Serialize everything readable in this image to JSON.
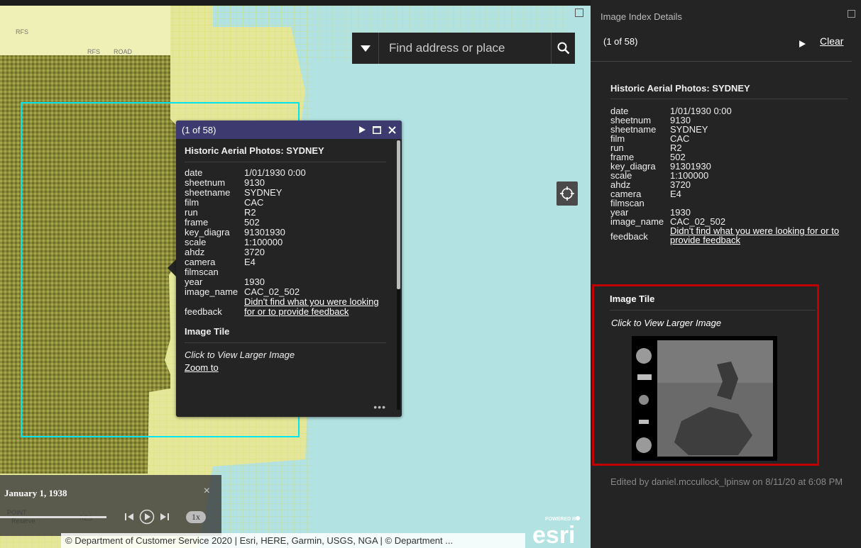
{
  "map": {
    "search_placeholder": "Find address or place",
    "map_labels": [
      "RFS",
      "RFS",
      "ROAD",
      "POINT",
      "Reserve",
      "RES"
    ],
    "timeslider": {
      "date": "January 1, 1938",
      "speed": "1x",
      "close": "×"
    },
    "attribution": "© Department of Customer Service 2020 | Esri, HERE, Garmin, USGS, NGA | © Department ...",
    "esri": {
      "powered_by": "POWERED BY",
      "brand": "esri"
    }
  },
  "popup": {
    "count": "(1 of 58)",
    "title": "Historic Aerial Photos: SYDNEY",
    "fields": [
      {
        "k": "date",
        "v": "1/01/1930 0:00"
      },
      {
        "k": "sheetnum",
        "v": "9130"
      },
      {
        "k": "sheetname",
        "v": "SYDNEY"
      },
      {
        "k": "film",
        "v": "CAC"
      },
      {
        "k": "run",
        "v": "R2"
      },
      {
        "k": "frame",
        "v": "502"
      },
      {
        "k": "key_diagra",
        "v": "91301930"
      },
      {
        "k": "scale",
        "v": "1:100000"
      },
      {
        "k": "ahdz",
        "v": "3720"
      },
      {
        "k": "camera",
        "v": "E4"
      },
      {
        "k": "filmscan",
        "v": ""
      },
      {
        "k": "year",
        "v": "1930"
      },
      {
        "k": "image_name",
        "v": "CAC_02_502"
      }
    ],
    "feedback_label": "feedback",
    "feedback_link": "Didn't find what you were looking for or to provide feedback",
    "image_tile": "Image Tile",
    "view_larger": "Click to View Larger Image",
    "zoom_to": "Zoom to",
    "more": "•••"
  },
  "panel": {
    "header": "Image Index Details",
    "count": "(1 of 58)",
    "clear": "Clear",
    "title": "Historic Aerial Photos: SYDNEY",
    "fields": [
      {
        "k": "date",
        "v": "1/01/1930 0:00"
      },
      {
        "k": "sheetnum",
        "v": "9130"
      },
      {
        "k": "sheetname",
        "v": "SYDNEY"
      },
      {
        "k": "film",
        "v": "CAC"
      },
      {
        "k": "run",
        "v": "R2"
      },
      {
        "k": "frame",
        "v": "502"
      },
      {
        "k": "key_diagra",
        "v": "91301930"
      },
      {
        "k": "scale",
        "v": "1:100000"
      },
      {
        "k": "ahdz",
        "v": "3720"
      },
      {
        "k": "camera",
        "v": "E4"
      },
      {
        "k": "filmscan",
        "v": ""
      },
      {
        "k": "year",
        "v": "1930"
      },
      {
        "k": "image_name",
        "v": "CAC_02_502"
      }
    ],
    "feedback_label": "feedback",
    "feedback_link": "Didn't find what you were looking for or to provide feedback",
    "image_tile": "Image Tile",
    "view_larger": "Click to View Larger Image",
    "edited": "Edited by daniel.mccullock_lpinsw on 8/11/20 at 6:08 PM"
  },
  "colors": {
    "water": "#b2e2e2",
    "panel_bg": "#242424",
    "popup_header": "#3c3a6e",
    "highlight_border": "#c00000",
    "selection_outline": "#00e5ee"
  }
}
